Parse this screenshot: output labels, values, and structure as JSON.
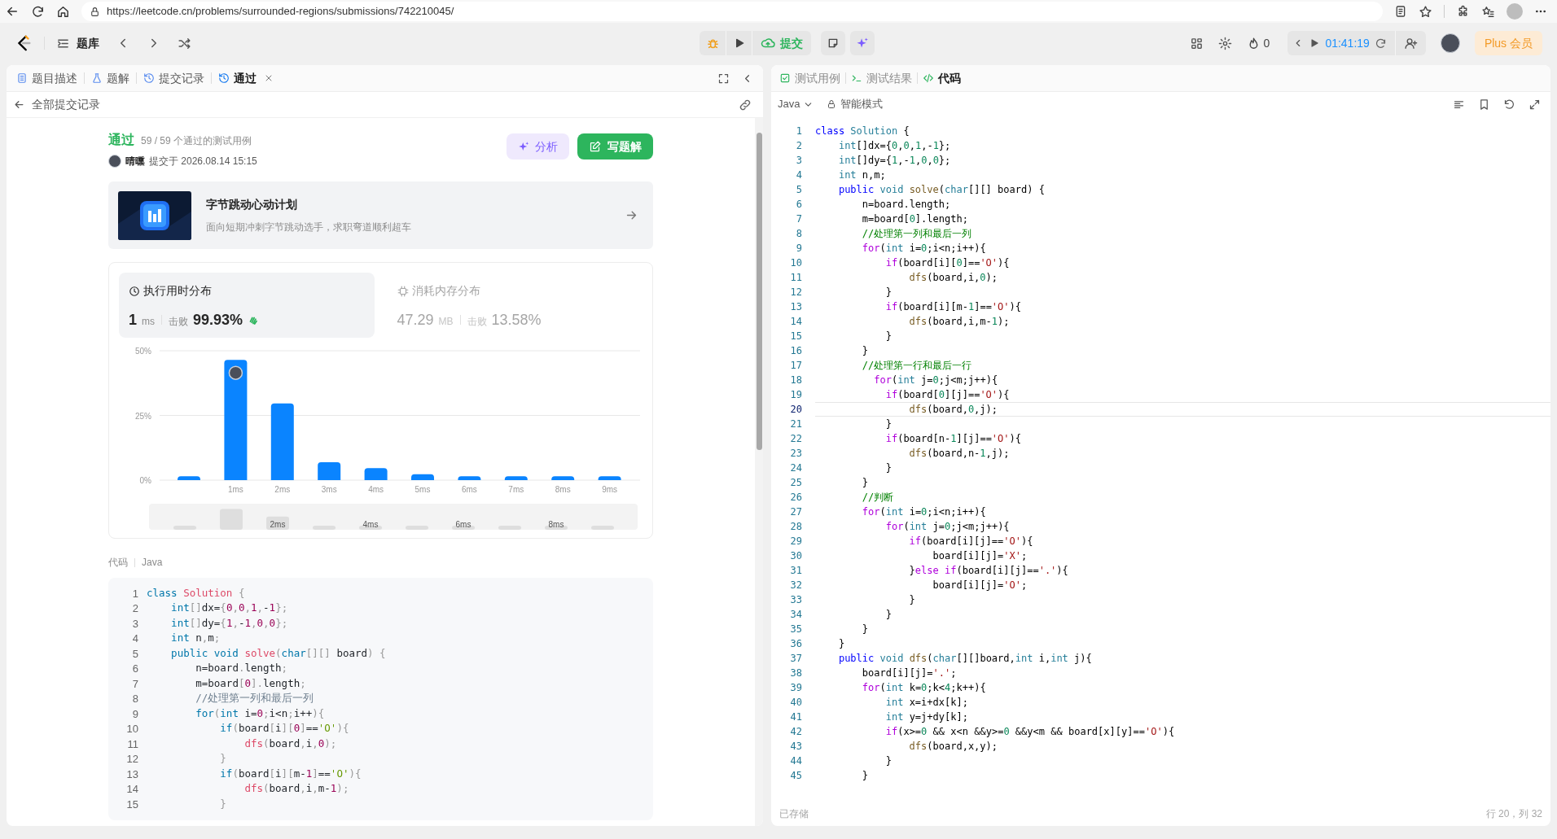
{
  "browser": {
    "url": "https://leetcode.cn/problems/surrounded-regions/submissions/742210045/"
  },
  "header": {
    "problem_bank": "题库",
    "submit": "提交",
    "streak": "0",
    "timer": "01:41:19",
    "plus": "Plus 会员"
  },
  "left_tabs": [
    {
      "label": "题目描述",
      "kind": "description",
      "selected": false,
      "closable": false
    },
    {
      "label": "题解",
      "kind": "solutions",
      "selected": false,
      "closable": false
    },
    {
      "label": "提交记录",
      "kind": "history",
      "selected": false,
      "closable": false
    },
    {
      "label": "通过",
      "kind": "result",
      "selected": true,
      "closable": true
    }
  ],
  "back_link": "全部提交记录",
  "submission": {
    "status": "通过",
    "cases": "59 / 59 个通过的测试用例",
    "user": "晴曛",
    "submitted": "提交于 2026.08.14 15:15",
    "analyze": "分析",
    "write_solution": "写题解"
  },
  "banner": {
    "title": "字节跳动心动计划",
    "subtitle": "面向短期冲刺字节跳动选手，求职弯道顺利超车"
  },
  "stats": [
    {
      "kind": "runtime",
      "label": "执行用时分布",
      "value": "1",
      "unit": "ms",
      "beats_label": "击败",
      "beats": "99.93%",
      "selected": true
    },
    {
      "kind": "memory",
      "label": "消耗内存分布",
      "value": "47.29",
      "unit": "MB",
      "beats_label": "击败",
      "beats": "13.58%",
      "selected": false
    }
  ],
  "chart_data": {
    "type": "bar",
    "categories": [
      null,
      "1ms",
      "2ms",
      "3ms",
      "4ms",
      "5ms",
      "6ms",
      "7ms",
      "8ms",
      "9ms"
    ],
    "series": [
      {
        "color": "#0a84ff",
        "values": [
          1.5,
          46.5,
          29.6,
          6.9,
          4.6,
          2.3,
          1.5,
          1.5,
          1.5,
          1.5
        ]
      }
    ],
    "ylim": [
      0,
      50
    ],
    "yticks": [
      {
        "value": 0,
        "label": "0%"
      },
      {
        "value": 25,
        "label": "25%"
      },
      {
        "value": 50,
        "label": "50%"
      }
    ],
    "annotations": [
      {
        "x": "1ms"
      }
    ]
  },
  "navigator_labels": [
    "2ms",
    "4ms",
    "6ms",
    "8ms"
  ],
  "code_label": "代码",
  "code_language": "Java",
  "code_lines": [
    {
      "n": "1",
      "text": "class Solution {"
    },
    {
      "n": "2",
      "text": "    int[]dx={0,0,1,-1};"
    },
    {
      "n": "3",
      "text": "    int[]dy={1,-1,0,0};"
    },
    {
      "n": "4",
      "text": "    int n,m;"
    },
    {
      "n": "5",
      "text": "    public void solve(char[][] board) {"
    },
    {
      "n": "6",
      "text": "        n=board.length;"
    },
    {
      "n": "7",
      "text": "        m=board[0].length;"
    },
    {
      "n": "8",
      "text": "        //处理第一列和最后一列"
    },
    {
      "n": "9",
      "text": "        for(int i=0;i<n;i++){"
    },
    {
      "n": "10",
      "text": "            if(board[i][0]=='O'){"
    },
    {
      "n": "11",
      "text": "                dfs(board,i,0);"
    },
    {
      "n": "12",
      "text": "            }"
    },
    {
      "n": "13",
      "text": "            if(board[i][m-1]=='O'){"
    },
    {
      "n": "14",
      "text": "                dfs(board,i,m-1);"
    },
    {
      "n": "15",
      "text": "            }"
    }
  ],
  "right_tabs": [
    {
      "label": "测试用例",
      "kind": "testcase",
      "selected": false
    },
    {
      "label": "测试结果",
      "kind": "result",
      "selected": false
    },
    {
      "label": "代码",
      "kind": "code",
      "selected": true
    }
  ],
  "editor": {
    "language": "Java",
    "mode": "智能模式",
    "saved": "已存储",
    "cursor": "行 20，列 32",
    "lines": [
      {
        "n": "1",
        "text": "class Solution {",
        "current": false
      },
      {
        "n": "2",
        "text": "    int[]dx={0,0,1,-1};",
        "current": false
      },
      {
        "n": "3",
        "text": "    int[]dy={1,-1,0,0};",
        "current": false
      },
      {
        "n": "4",
        "text": "    int n,m;",
        "current": false
      },
      {
        "n": "5",
        "text": "    public void solve(char[][] board) {",
        "current": false
      },
      {
        "n": "6",
        "text": "        n=board.length;",
        "current": false
      },
      {
        "n": "7",
        "text": "        m=board[0].length;",
        "current": false
      },
      {
        "n": "8",
        "text": "        //处理第一列和最后一列",
        "current": false
      },
      {
        "n": "9",
        "text": "        for(int i=0;i<n;i++){",
        "current": false
      },
      {
        "n": "10",
        "text": "            if(board[i][0]=='O'){",
        "current": false
      },
      {
        "n": "11",
        "text": "                dfs(board,i,0);",
        "current": false
      },
      {
        "n": "12",
        "text": "            }",
        "current": false
      },
      {
        "n": "13",
        "text": "            if(board[i][m-1]=='O'){",
        "current": false
      },
      {
        "n": "14",
        "text": "                dfs(board,i,m-1);",
        "current": false
      },
      {
        "n": "15",
        "text": "            }",
        "current": false
      },
      {
        "n": "16",
        "text": "        }",
        "current": false
      },
      {
        "n": "17",
        "text": "        //处理第一行和最后一行",
        "current": false
      },
      {
        "n": "18",
        "text": "          for(int j=0;j<m;j++){",
        "current": false
      },
      {
        "n": "19",
        "text": "            if(board[0][j]=='O'){",
        "current": false
      },
      {
        "n": "20",
        "text": "                dfs(board,0,j);",
        "current": true
      },
      {
        "n": "21",
        "text": "            }",
        "current": false
      },
      {
        "n": "22",
        "text": "            if(board[n-1][j]=='O'){",
        "current": false
      },
      {
        "n": "23",
        "text": "                dfs(board,n-1,j);",
        "current": false
      },
      {
        "n": "24",
        "text": "            }",
        "current": false
      },
      {
        "n": "25",
        "text": "        }",
        "current": false
      },
      {
        "n": "26",
        "text": "        //判断",
        "current": false
      },
      {
        "n": "27",
        "text": "        for(int i=0;i<n;i++){",
        "current": false
      },
      {
        "n": "28",
        "text": "            for(int j=0;j<m;j++){",
        "current": false
      },
      {
        "n": "29",
        "text": "                if(board[i][j]=='O'){",
        "current": false
      },
      {
        "n": "30",
        "text": "                    board[i][j]='X';",
        "current": false
      },
      {
        "n": "31",
        "text": "                }else if(board[i][j]=='.'){",
        "current": false
      },
      {
        "n": "32",
        "text": "                    board[i][j]='O';",
        "current": false
      },
      {
        "n": "33",
        "text": "                }",
        "current": false
      },
      {
        "n": "34",
        "text": "            }",
        "current": false
      },
      {
        "n": "35",
        "text": "        }",
        "current": false
      },
      {
        "n": "36",
        "text": "    }",
        "current": false
      },
      {
        "n": "37",
        "text": "    public void dfs(char[][]board,int i,int j){",
        "current": false
      },
      {
        "n": "38",
        "text": "        board[i][j]='.';",
        "current": false
      },
      {
        "n": "39",
        "text": "        for(int k=0;k<4;k++){",
        "current": false
      },
      {
        "n": "40",
        "text": "            int x=i+dx[k];",
        "current": false
      },
      {
        "n": "41",
        "text": "            int y=j+dy[k];",
        "current": false
      },
      {
        "n": "42",
        "text": "            if(x>=0 && x<n &&y>=0 &&y<m && board[x][y]=='O'){",
        "current": false
      },
      {
        "n": "43",
        "text": "                dfs(board,x,y);",
        "current": false
      },
      {
        "n": "44",
        "text": "            }",
        "current": false
      },
      {
        "n": "45",
        "text": "        }",
        "current": false
      }
    ]
  }
}
